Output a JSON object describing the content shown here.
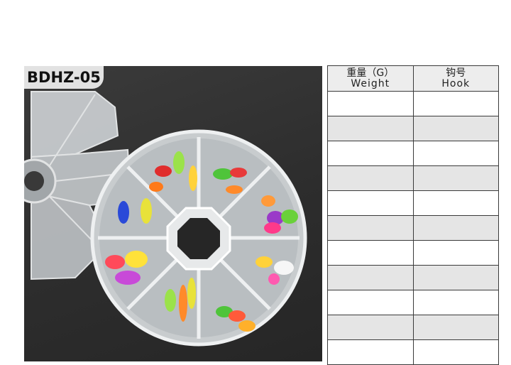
{
  "product": {
    "model_label": "BDHZ-05"
  },
  "spec_table": {
    "header_weight_cn": "重量（G）",
    "header_weight_en": "Weight",
    "header_hook_cn": "钩号",
    "header_hook_en": "Hook",
    "rows": [
      {
        "weight": "",
        "hook": ""
      },
      {
        "weight": "",
        "hook": ""
      },
      {
        "weight": "",
        "hook": ""
      },
      {
        "weight": "",
        "hook": ""
      },
      {
        "weight": "",
        "hook": ""
      },
      {
        "weight": "",
        "hook": ""
      },
      {
        "weight": "",
        "hook": ""
      },
      {
        "weight": "",
        "hook": ""
      },
      {
        "weight": "",
        "hook": ""
      },
      {
        "weight": "",
        "hook": ""
      },
      {
        "weight": "",
        "hook": ""
      }
    ]
  },
  "colors": {
    "table_border": "#3a3a3a",
    "row_shaded": "#e5e5e5",
    "photo_background": "#2d2d2d"
  }
}
